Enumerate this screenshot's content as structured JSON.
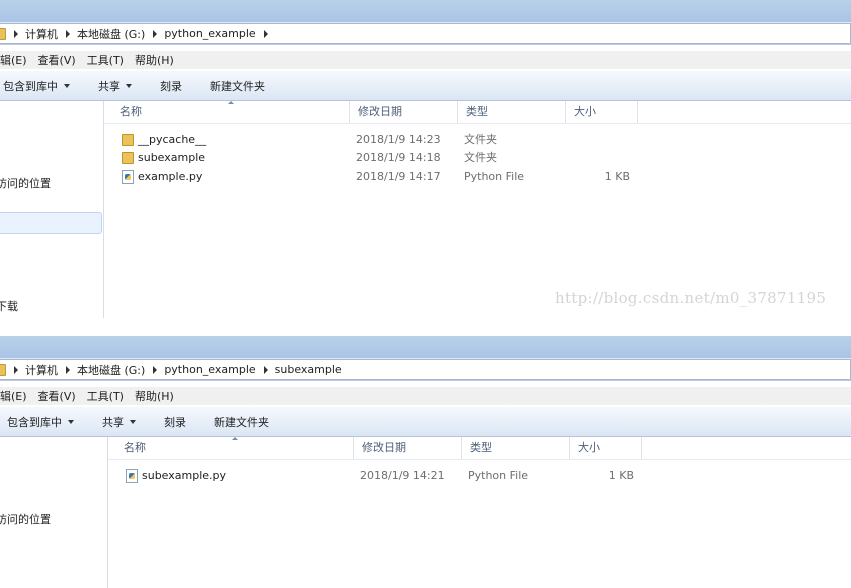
{
  "watermark": "http://blog.csdn.net/m0_37871195",
  "windows": [
    {
      "breadcrumbs": [
        "计算机",
        "本地磁盘 (G:)",
        "python_example"
      ],
      "menu": [
        "编辑(E)",
        "查看(V)",
        "工具(T)",
        "帮助(H)"
      ],
      "toolbar": {
        "include": "包含到库中",
        "share": "共享",
        "burn": "刻录",
        "new_folder": "新建文件夹"
      },
      "nav": {
        "recent": "访问的位置",
        "downloads": "下载"
      },
      "columns": {
        "name": "名称",
        "date": "修改日期",
        "type": "类型",
        "size": "大小"
      },
      "files": [
        {
          "name": "__pycache__",
          "date": "2018/1/9 14:23",
          "type": "文件夹",
          "size": "",
          "icon": "folder-icon"
        },
        {
          "name": "subexample",
          "date": "2018/1/9 14:18",
          "type": "文件夹",
          "size": "",
          "icon": "folder-icon"
        },
        {
          "name": "example.py",
          "date": "2018/1/9 14:17",
          "type": "Python File",
          "size": "1 KB",
          "icon": "python-file-icon"
        }
      ]
    },
    {
      "breadcrumbs": [
        "计算机",
        "本地磁盘 (G:)",
        "python_example",
        "subexample"
      ],
      "menu": [
        "编辑(E)",
        "查看(V)",
        "工具(T)",
        "帮助(H)"
      ],
      "toolbar": {
        "include": "包含到库中",
        "share": "共享",
        "burn": "刻录",
        "new_folder": "新建文件夹"
      },
      "nav": {
        "recent": "访问的位置"
      },
      "columns": {
        "name": "名称",
        "date": "修改日期",
        "type": "类型",
        "size": "大小"
      },
      "files": [
        {
          "name": "subexample.py",
          "date": "2018/1/9 14:21",
          "type": "Python File",
          "size": "1 KB",
          "icon": "python-file-icon"
        }
      ]
    }
  ]
}
